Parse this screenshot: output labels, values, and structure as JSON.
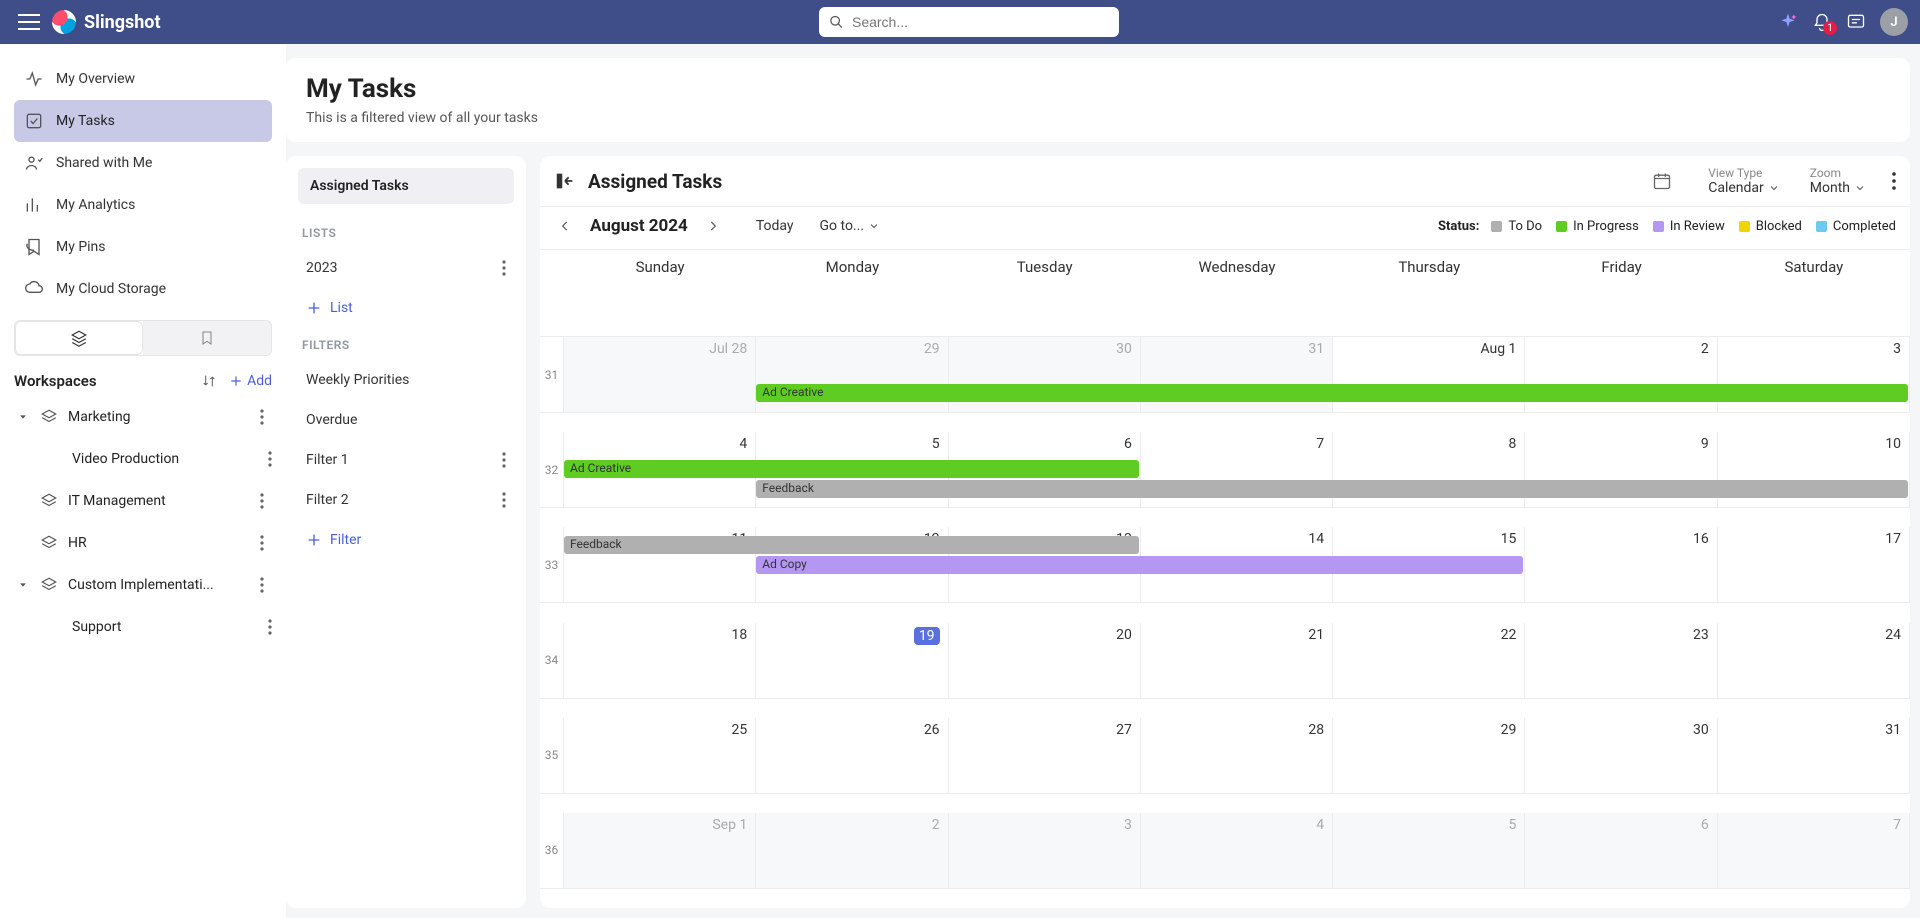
{
  "brand": {
    "name": "Slingshot"
  },
  "search": {
    "placeholder": "Search..."
  },
  "notifications": {
    "count": "1"
  },
  "avatar": {
    "initial": "J"
  },
  "sidebar": {
    "items": [
      {
        "label": "My Overview"
      },
      {
        "label": "My Tasks"
      },
      {
        "label": "Shared with Me"
      },
      {
        "label": "My Analytics"
      },
      {
        "label": "My Pins"
      },
      {
        "label": "My Cloud Storage"
      }
    ],
    "workspaces_title": "Workspaces",
    "add_label": "Add",
    "workspaces": [
      {
        "label": "Marketing",
        "expandable": true,
        "children": [
          {
            "label": "Video Production"
          }
        ]
      },
      {
        "label": "IT Management",
        "expandable": false
      },
      {
        "label": "HR",
        "expandable": false
      },
      {
        "label": "Custom Implementati...",
        "expandable": true,
        "children": [
          {
            "label": "Support"
          }
        ]
      }
    ]
  },
  "page": {
    "title": "My Tasks",
    "subtitle": "This is a filtered view of all your tasks"
  },
  "task_panel": {
    "section": "Assigned Tasks",
    "lists_label": "LISTS",
    "lists": [
      {
        "label": "2023"
      }
    ],
    "add_list_label": "List",
    "filters_label": "FILTERS",
    "filters": [
      {
        "label": "Weekly Priorities"
      },
      {
        "label": "Overdue"
      },
      {
        "label": "Filter 1",
        "has_more": true
      },
      {
        "label": "Filter 2",
        "has_more": true
      }
    ],
    "add_filter_label": "Filter"
  },
  "calendar": {
    "title": "Assigned Tasks",
    "view_type_label": "View Type",
    "view_type_value": "Calendar",
    "zoom_label": "Zoom",
    "zoom_value": "Month",
    "month": "August 2024",
    "today_label": "Today",
    "goto_label": "Go to...",
    "status_label": "Status:",
    "legend": [
      {
        "label": "To Do",
        "color": "#b0b0b0"
      },
      {
        "label": "In Progress",
        "color": "#5ecc22"
      },
      {
        "label": "In Review",
        "color": "#b497f2"
      },
      {
        "label": "Blocked",
        "color": "#f2d400"
      },
      {
        "label": "Completed",
        "color": "#6cc9f0"
      }
    ],
    "dow": [
      "Sunday",
      "Monday",
      "Tuesday",
      "Wednesday",
      "Thursday",
      "Friday",
      "Saturday"
    ],
    "weeks": [
      "31",
      "32",
      "33",
      "34",
      "35",
      "36"
    ],
    "grid": [
      [
        {
          "d": "Jul 28",
          "other": true
        },
        {
          "d": "29",
          "other": true
        },
        {
          "d": "30",
          "other": true
        },
        {
          "d": "31",
          "other": true
        },
        {
          "d": "Aug 1"
        },
        {
          "d": "2"
        },
        {
          "d": "3"
        }
      ],
      [
        {
          "d": "4"
        },
        {
          "d": "5"
        },
        {
          "d": "6"
        },
        {
          "d": "7"
        },
        {
          "d": "8"
        },
        {
          "d": "9"
        },
        {
          "d": "10"
        }
      ],
      [
        {
          "d": "11"
        },
        {
          "d": "12"
        },
        {
          "d": "13"
        },
        {
          "d": "14"
        },
        {
          "d": "15"
        },
        {
          "d": "16"
        },
        {
          "d": "17"
        }
      ],
      [
        {
          "d": "18"
        },
        {
          "d": "19",
          "today": true
        },
        {
          "d": "20"
        },
        {
          "d": "21"
        },
        {
          "d": "22"
        },
        {
          "d": "23"
        },
        {
          "d": "24"
        }
      ],
      [
        {
          "d": "25"
        },
        {
          "d": "26"
        },
        {
          "d": "27"
        },
        {
          "d": "28"
        },
        {
          "d": "29"
        },
        {
          "d": "30"
        },
        {
          "d": "31"
        }
      ],
      [
        {
          "d": "Sep 1",
          "other": true
        },
        {
          "d": "2",
          "other": true
        },
        {
          "d": "3",
          "other": true
        },
        {
          "d": "4",
          "other": true
        },
        {
          "d": "5",
          "other": true
        },
        {
          "d": "6",
          "other": true
        },
        {
          "d": "7",
          "other": true
        }
      ]
    ],
    "events": [
      {
        "label": "Ad Creative",
        "row": 1,
        "startCol": 1,
        "endCol": 7,
        "slot": 0,
        "color": "#5ecc22"
      },
      {
        "label": "Ad Creative",
        "row": 2,
        "startCol": 0,
        "endCol": 3,
        "slot": 0,
        "color": "#5ecc22"
      },
      {
        "label": "Feedback",
        "row": 2,
        "startCol": 1,
        "endCol": 7,
        "slot": 1,
        "color": "#b0b0b0"
      },
      {
        "label": "Feedback",
        "row": 3,
        "startCol": 0,
        "endCol": 3,
        "slot": 0,
        "color": "#b0b0b0"
      },
      {
        "label": "Ad Copy",
        "row": 3,
        "startCol": 1,
        "endCol": 5,
        "slot": 1,
        "color": "#b497f2"
      }
    ]
  }
}
